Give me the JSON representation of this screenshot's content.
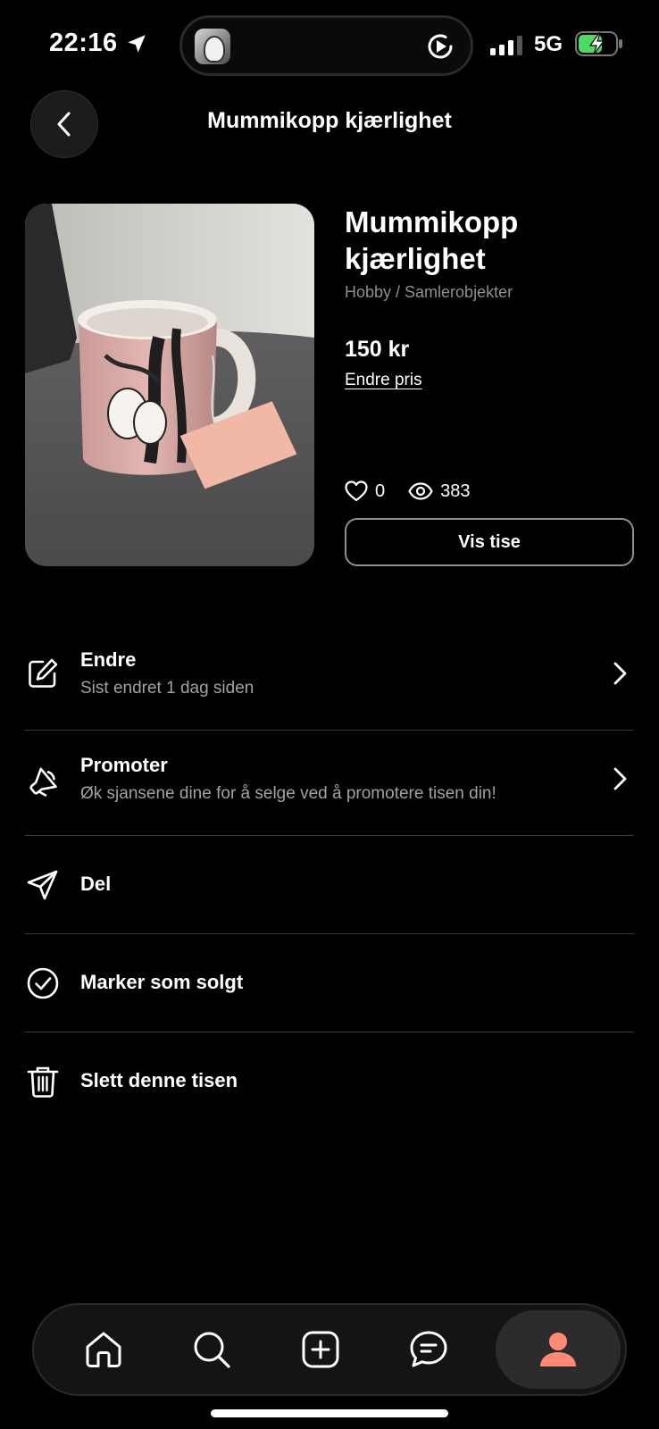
{
  "status_bar": {
    "time": "22:16",
    "network": "5G",
    "icons": [
      "location-arrow-icon",
      "play-icon",
      "signal-icon",
      "battery-charging-icon"
    ]
  },
  "header": {
    "title": "Mummikopp kjærlighet",
    "back_icon": "chevron-left-icon"
  },
  "product": {
    "name": "Mummikopp kjærlighet",
    "category": "Hobby / Samlerobjekter",
    "price": "150 kr",
    "change_price_label": "Endre pris",
    "likes": "0",
    "views": "383",
    "view_button_label": "Vis tise"
  },
  "menu": {
    "items": [
      {
        "label": "Endre",
        "sub": "Sist endret 1 dag siden",
        "icon": "edit-icon"
      },
      {
        "label": "Promoter",
        "sub": "Øk sjansene dine for å selge ved å promotere tisen din!",
        "icon": "megaphone-icon"
      },
      {
        "label": "Del",
        "icon": "send-icon"
      },
      {
        "label": "Marker som solgt",
        "icon": "check-circle-icon"
      },
      {
        "label": "Slett denne tisen",
        "icon": "trash-icon"
      }
    ]
  },
  "tab_bar": {
    "tabs": [
      "home-icon",
      "search-icon",
      "add-icon",
      "messages-icon",
      "profile-icon"
    ],
    "active": "profile-icon"
  },
  "colors": {
    "background": "#000000",
    "accent": "#ff8a73",
    "secondary_text": "#8e8e93",
    "divider": "#3a3a3c"
  }
}
